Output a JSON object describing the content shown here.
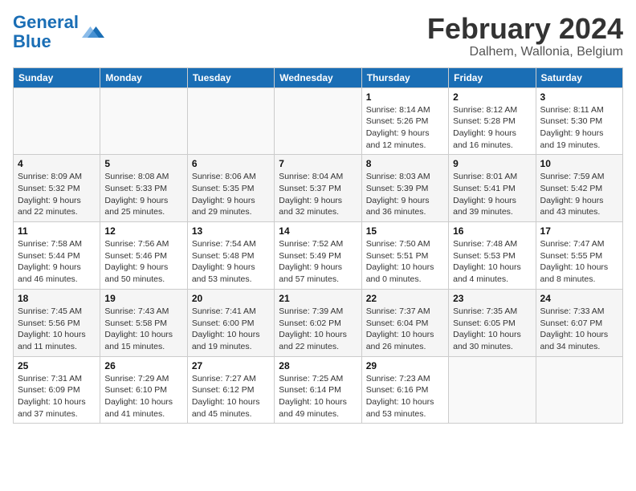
{
  "logo": {
    "line1": "General",
    "line2": "Blue"
  },
  "title": "February 2024",
  "location": "Dalhem, Wallonia, Belgium",
  "headers": [
    "Sunday",
    "Monday",
    "Tuesday",
    "Wednesday",
    "Thursday",
    "Friday",
    "Saturday"
  ],
  "weeks": [
    [
      {
        "day": "",
        "info": ""
      },
      {
        "day": "",
        "info": ""
      },
      {
        "day": "",
        "info": ""
      },
      {
        "day": "",
        "info": ""
      },
      {
        "day": "1",
        "info": "Sunrise: 8:14 AM\nSunset: 5:26 PM\nDaylight: 9 hours\nand 12 minutes."
      },
      {
        "day": "2",
        "info": "Sunrise: 8:12 AM\nSunset: 5:28 PM\nDaylight: 9 hours\nand 16 minutes."
      },
      {
        "day": "3",
        "info": "Sunrise: 8:11 AM\nSunset: 5:30 PM\nDaylight: 9 hours\nand 19 minutes."
      }
    ],
    [
      {
        "day": "4",
        "info": "Sunrise: 8:09 AM\nSunset: 5:32 PM\nDaylight: 9 hours\nand 22 minutes."
      },
      {
        "day": "5",
        "info": "Sunrise: 8:08 AM\nSunset: 5:33 PM\nDaylight: 9 hours\nand 25 minutes."
      },
      {
        "day": "6",
        "info": "Sunrise: 8:06 AM\nSunset: 5:35 PM\nDaylight: 9 hours\nand 29 minutes."
      },
      {
        "day": "7",
        "info": "Sunrise: 8:04 AM\nSunset: 5:37 PM\nDaylight: 9 hours\nand 32 minutes."
      },
      {
        "day": "8",
        "info": "Sunrise: 8:03 AM\nSunset: 5:39 PM\nDaylight: 9 hours\nand 36 minutes."
      },
      {
        "day": "9",
        "info": "Sunrise: 8:01 AM\nSunset: 5:41 PM\nDaylight: 9 hours\nand 39 minutes."
      },
      {
        "day": "10",
        "info": "Sunrise: 7:59 AM\nSunset: 5:42 PM\nDaylight: 9 hours\nand 43 minutes."
      }
    ],
    [
      {
        "day": "11",
        "info": "Sunrise: 7:58 AM\nSunset: 5:44 PM\nDaylight: 9 hours\nand 46 minutes."
      },
      {
        "day": "12",
        "info": "Sunrise: 7:56 AM\nSunset: 5:46 PM\nDaylight: 9 hours\nand 50 minutes."
      },
      {
        "day": "13",
        "info": "Sunrise: 7:54 AM\nSunset: 5:48 PM\nDaylight: 9 hours\nand 53 minutes."
      },
      {
        "day": "14",
        "info": "Sunrise: 7:52 AM\nSunset: 5:49 PM\nDaylight: 9 hours\nand 57 minutes."
      },
      {
        "day": "15",
        "info": "Sunrise: 7:50 AM\nSunset: 5:51 PM\nDaylight: 10 hours\nand 0 minutes."
      },
      {
        "day": "16",
        "info": "Sunrise: 7:48 AM\nSunset: 5:53 PM\nDaylight: 10 hours\nand 4 minutes."
      },
      {
        "day": "17",
        "info": "Sunrise: 7:47 AM\nSunset: 5:55 PM\nDaylight: 10 hours\nand 8 minutes."
      }
    ],
    [
      {
        "day": "18",
        "info": "Sunrise: 7:45 AM\nSunset: 5:56 PM\nDaylight: 10 hours\nand 11 minutes."
      },
      {
        "day": "19",
        "info": "Sunrise: 7:43 AM\nSunset: 5:58 PM\nDaylight: 10 hours\nand 15 minutes."
      },
      {
        "day": "20",
        "info": "Sunrise: 7:41 AM\nSunset: 6:00 PM\nDaylight: 10 hours\nand 19 minutes."
      },
      {
        "day": "21",
        "info": "Sunrise: 7:39 AM\nSunset: 6:02 PM\nDaylight: 10 hours\nand 22 minutes."
      },
      {
        "day": "22",
        "info": "Sunrise: 7:37 AM\nSunset: 6:04 PM\nDaylight: 10 hours\nand 26 minutes."
      },
      {
        "day": "23",
        "info": "Sunrise: 7:35 AM\nSunset: 6:05 PM\nDaylight: 10 hours\nand 30 minutes."
      },
      {
        "day": "24",
        "info": "Sunrise: 7:33 AM\nSunset: 6:07 PM\nDaylight: 10 hours\nand 34 minutes."
      }
    ],
    [
      {
        "day": "25",
        "info": "Sunrise: 7:31 AM\nSunset: 6:09 PM\nDaylight: 10 hours\nand 37 minutes."
      },
      {
        "day": "26",
        "info": "Sunrise: 7:29 AM\nSunset: 6:10 PM\nDaylight: 10 hours\nand 41 minutes."
      },
      {
        "day": "27",
        "info": "Sunrise: 7:27 AM\nSunset: 6:12 PM\nDaylight: 10 hours\nand 45 minutes."
      },
      {
        "day": "28",
        "info": "Sunrise: 7:25 AM\nSunset: 6:14 PM\nDaylight: 10 hours\nand 49 minutes."
      },
      {
        "day": "29",
        "info": "Sunrise: 7:23 AM\nSunset: 6:16 PM\nDaylight: 10 hours\nand 53 minutes."
      },
      {
        "day": "",
        "info": ""
      },
      {
        "day": "",
        "info": ""
      }
    ]
  ]
}
